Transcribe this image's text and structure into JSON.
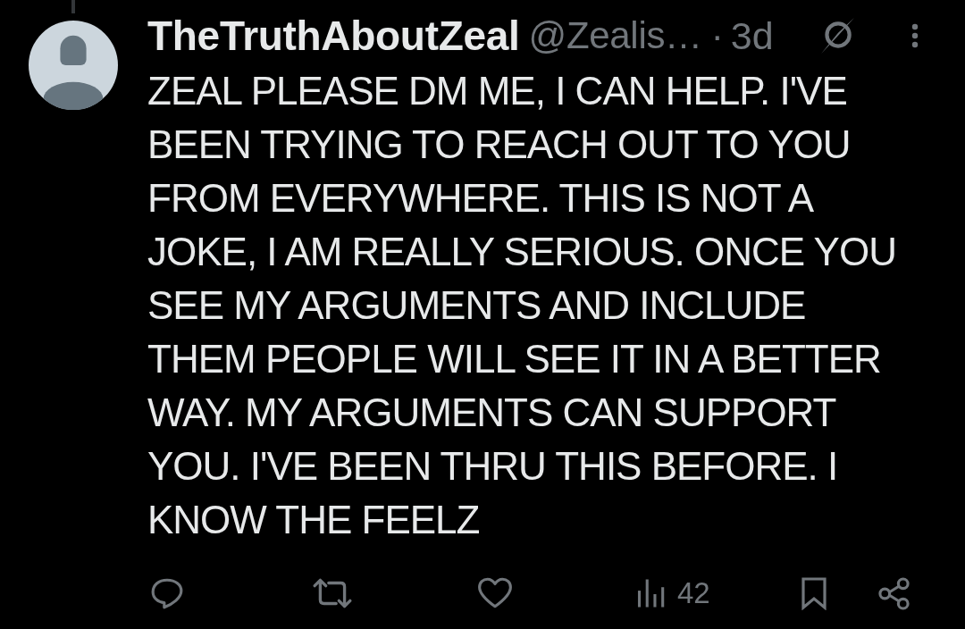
{
  "post": {
    "author": {
      "name": "TheTruthAboutZeal",
      "handle": "@Zealis…"
    },
    "separator": "·",
    "time": "3d",
    "text": "ZEAL PLEASE DM ME, I CAN HELP. I'VE BEEN TRYING TO REACH OUT TO YOU FROM EVERYWHERE. THIS IS NOT A JOKE, I AM REALLY SERIOUS. ONCE YOU SEE MY ARGUMENTS AND INCLUDE THEM PEOPLE WILL SEE IT IN A BETTER WAY. MY ARGUMENTS CAN SUPPORT YOU. I'VE BEEN THRU THIS BEFORE. I KNOW THE FEELZ"
  },
  "actions": [
    {
      "kind": "reply"
    },
    {
      "kind": "repost"
    },
    {
      "kind": "like"
    },
    {
      "kind": "views",
      "count": "42"
    },
    {
      "kind": "bookmark"
    },
    {
      "kind": "share"
    }
  ]
}
